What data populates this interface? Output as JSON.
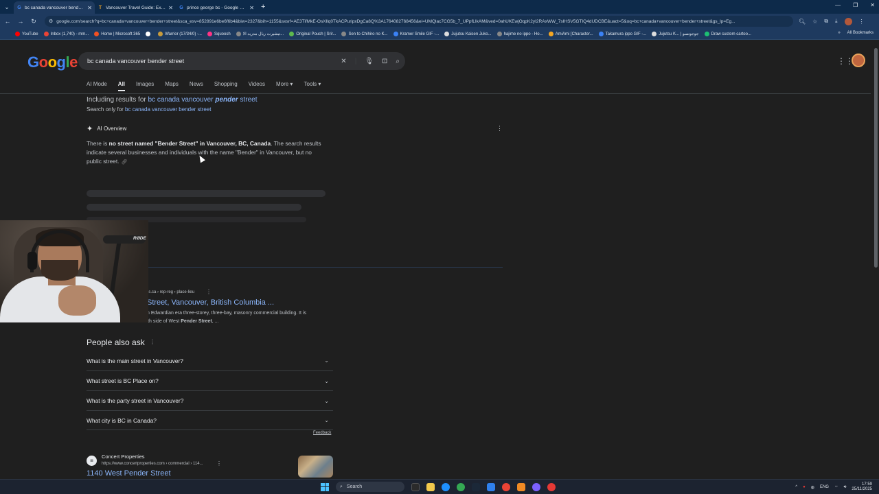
{
  "browser": {
    "tabs": [
      {
        "title": "bc canada vancouver bender st",
        "favicon": "G",
        "active": true
      },
      {
        "title": "Vancouver Travel Guide: Explor",
        "favicon": "T",
        "active": false
      },
      {
        "title": "prince george bc - Google Sea",
        "favicon": "G",
        "active": false
      }
    ],
    "url": "google.com/search?q=bc+canada+vancouver+bender+street&sca_esv=852891e6be6f6b4&biw=2327&bih=1155&sxsrf=AE3TifMkE-OsXIlq0TkACPuripxDgCa8Q%3A1764082768456&ei=UMQlac7CG5b_7_UPpfLIkAM&ved=0ahUKEwjOqpK2yI2RAxWW_7sIHSV5GTIQ4dUDCBE&uact=5&oq=bc+canada+vancouver+bender+street&gs_lp=Eg...",
    "bookmarks": [
      {
        "label": "YouTube",
        "color": "#ff0000"
      },
      {
        "label": "Inbox (1,740) - mm...",
        "color": "#ea4335"
      },
      {
        "label": "Home | Microsoft 365",
        "color": "#f25022"
      },
      {
        "label": "",
        "color": "#ffffff"
      },
      {
        "label": "Warrior (17/34/0) -...",
        "color": "#c89b3c"
      },
      {
        "label": "Squoosh",
        "color": "#ff3385"
      },
      {
        "label": "تيشيرت ريال مدريد الا...",
        "color": "#888888"
      },
      {
        "label": "Original Pouch | Srir...",
        "color": "#5fb94e"
      },
      {
        "label": "Sen to Chihiro no K...",
        "color": "#888888"
      },
      {
        "label": "Kramer Smile GIF -...",
        "color": "#3b82f6"
      },
      {
        "label": "Jujutsu Kaisen Juko...",
        "color": "#dddddd"
      },
      {
        "label": "hajime no ippo - Ho...",
        "color": "#888888"
      },
      {
        "label": "AmiAmi [Character...",
        "color": "#f5a623"
      },
      {
        "label": "Takamura ippo GIF -...",
        "color": "#3b82f6"
      },
      {
        "label": "Jujutsu K... | جوجوتسو",
        "color": "#dddddd"
      },
      {
        "label": "Draw custom cartoo...",
        "color": "#1dbf73"
      }
    ],
    "all_bookmarks": "All Bookmarks"
  },
  "google": {
    "query": "bc canada vancouver bender street",
    "nav_tabs": [
      "AI Mode",
      "All",
      "Images",
      "Maps",
      "News",
      "Shopping",
      "Videos",
      "More ▾",
      "Tools ▾"
    ],
    "spelling": {
      "including_prefix": "Including results for ",
      "corrected_pre": "bc canada vancouver ",
      "corrected_word": "pender",
      "corrected_post": " street",
      "search_only_prefix": "Search only for ",
      "original_query": "bc canada vancouver bender street"
    },
    "ai_overview": {
      "heading": "AI Overview",
      "p1": "There is ",
      "bold1": "no street named \"Bender Street\" in Vancouver, BC, Canada",
      "p2": ". The search results indicate several businesses and individuals with the name \"Bender\" in Vancouver, but no public street."
    },
    "result1": {
      "breadcrumb": "es.ca › rep-reg › place-lieu",
      "title": "Street, Vancouver, British Columbia ...",
      "snippet_line1": "n Edwardian era three-storey, three-bay, masonry commercial building. It is",
      "snippet_line2_pre": "located mid-block on the south side of West ",
      "snippet_bold": "Pender Street",
      "snippet_line2_post": ", ..."
    },
    "people_also_ask": {
      "title": "People also ask",
      "questions": [
        "What is the main street in Vancouver?",
        "What street is BC Place on?",
        "What is the party street in Vancouver?",
        "What city is BC in Canada?"
      ],
      "feedback": "Feedback"
    },
    "result2": {
      "site": "Concert Properties",
      "url": "https://www.concertproperties.com › commercial › 114...",
      "title": "1140 West Pender Street"
    }
  },
  "webcam": {
    "mic_brand": "RØDE"
  },
  "taskbar": {
    "search": "Search",
    "lang": "ENG",
    "time": "17:59",
    "date": "25/11/2025"
  }
}
